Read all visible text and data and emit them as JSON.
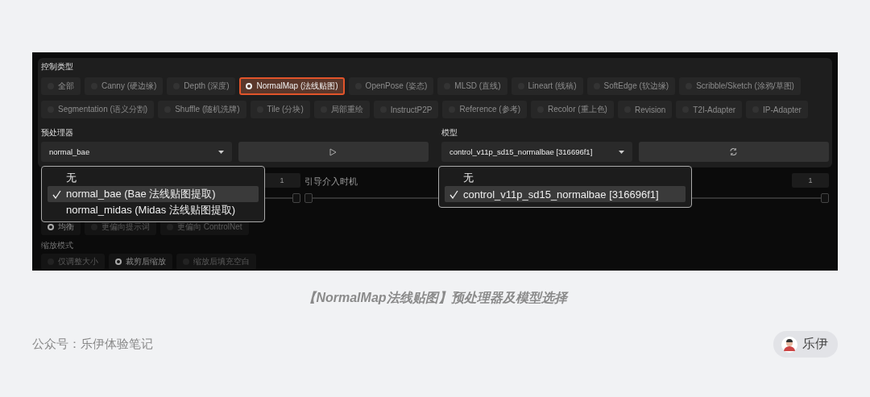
{
  "control_type": {
    "label": "控制类型",
    "rows": [
      {
        "items": [
          {
            "label": "全部",
            "selected": false
          },
          {
            "label": "Canny (硬边缘)",
            "selected": false
          },
          {
            "label": "Depth (深度)",
            "selected": false
          },
          {
            "label": "NormalMap (法线贴图)",
            "selected": true
          },
          {
            "label": "OpenPose (姿态)",
            "selected": false
          },
          {
            "label": "MLSD (直线)",
            "selected": false
          },
          {
            "label": "Lineart (线稿)",
            "selected": false
          },
          {
            "label": "SoftEdge (软边缘)",
            "selected": false
          },
          {
            "label": "Scribble/Sketch (涂鸦/草图)",
            "selected": false
          }
        ]
      },
      {
        "items": [
          {
            "label": "Segmentation (语义分割)",
            "selected": false
          },
          {
            "label": "Shuffle (随机洗牌)",
            "selected": false
          },
          {
            "label": "Tile (分块)",
            "selected": false
          },
          {
            "label": "局部重绘",
            "selected": false
          },
          {
            "label": "InstructP2P",
            "selected": false
          },
          {
            "label": "Reference (参考)",
            "selected": false
          },
          {
            "label": "Recolor (重上色)",
            "selected": false
          },
          {
            "label": "Revision",
            "selected": false
          },
          {
            "label": "T2I-Adapter",
            "selected": false
          },
          {
            "label": "IP-Adapter",
            "selected": false
          }
        ]
      }
    ]
  },
  "preprocessor": {
    "label": "预处理器",
    "value": "normal_bae",
    "options": [
      {
        "label": "无",
        "selected": false
      },
      {
        "label": "normal_bae (Bae 法线贴图提取)",
        "selected": true
      },
      {
        "label": "normal_midas (Midas 法线贴图提取)",
        "selected": false
      }
    ]
  },
  "model": {
    "label": "模型",
    "value": "control_v11p_sd15_normalbae [316696f1]",
    "options": [
      {
        "label": "无",
        "selected": false
      },
      {
        "label": "control_v11p_sd15_normalbae [316696f1]",
        "selected": true
      }
    ]
  },
  "sliders": [
    {
      "value": "1",
      "level": 1
    },
    {
      "label": "引导介入时机",
      "level": 0
    },
    {
      "value": "1",
      "level": 1
    }
  ],
  "control_mode": [
    {
      "label": "均衡",
      "selected": true
    },
    {
      "label": "更偏向提示词",
      "selected": false
    },
    {
      "label": "更偏向 ControlNet",
      "selected": false
    }
  ],
  "resize_mode": {
    "label": "缩放模式",
    "items": [
      {
        "label": "仅调整大小",
        "selected": false
      },
      {
        "label": "裁剪后缩放",
        "selected": true
      },
      {
        "label": "缩放后填充空白",
        "selected": false
      }
    ]
  },
  "caption": "【NormalMap法线贴图】预处理器及模型选择",
  "source": "公众号：乐伊体验笔记",
  "author": "乐伊"
}
